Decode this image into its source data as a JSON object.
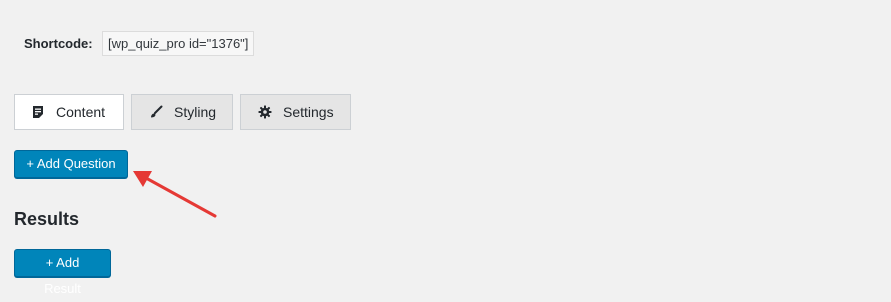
{
  "shortcode": {
    "label": "Shortcode:",
    "value": "[wp_quiz_pro id=\"1376\"]"
  },
  "tabs": [
    {
      "label": "Content",
      "icon": "content-icon",
      "active": true
    },
    {
      "label": "Styling",
      "icon": "brush-icon",
      "active": false
    },
    {
      "label": "Settings",
      "icon": "gear-icon",
      "active": false
    }
  ],
  "questions": {
    "add_label": "+ Add Question"
  },
  "results": {
    "heading": "Results",
    "add_label": "+ Add Result"
  },
  "colors": {
    "primary": "#0085ba",
    "background": "#f1f1f1",
    "arrow": "#e53935"
  }
}
